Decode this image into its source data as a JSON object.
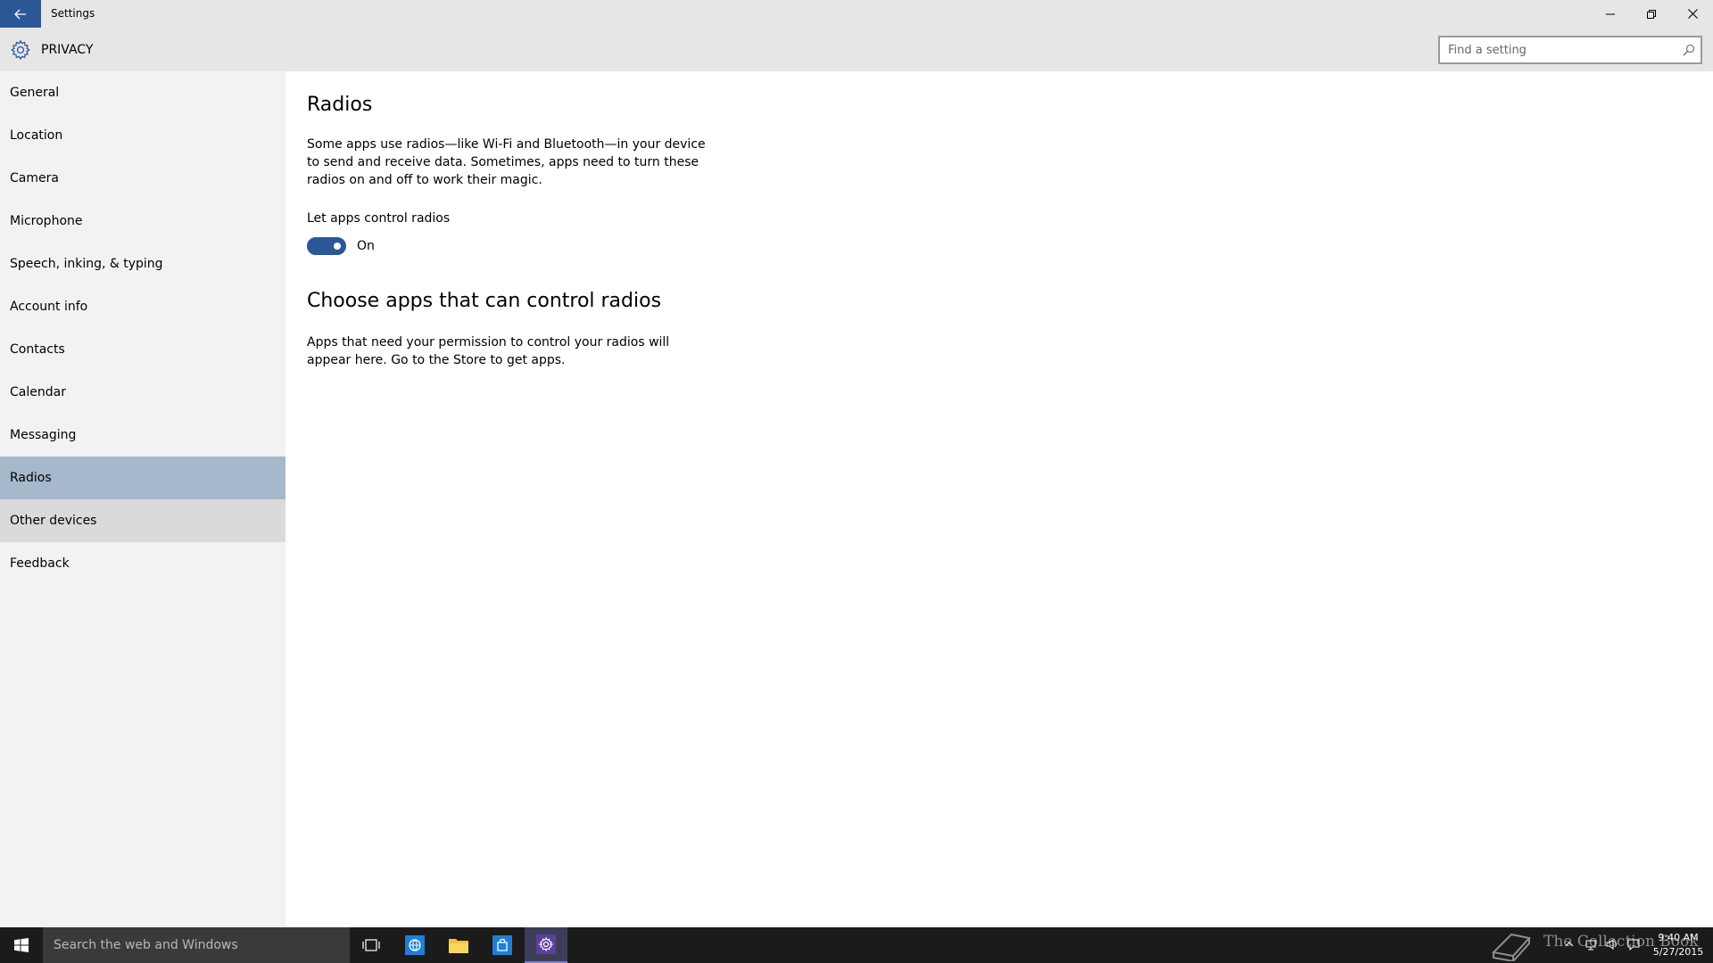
{
  "window": {
    "title": "Settings"
  },
  "header": {
    "title": "PRIVACY",
    "search_placeholder": "Find a setting"
  },
  "sidebar": {
    "items": [
      {
        "label": "General"
      },
      {
        "label": "Location"
      },
      {
        "label": "Camera"
      },
      {
        "label": "Microphone"
      },
      {
        "label": "Speech, inking, & typing"
      },
      {
        "label": "Account info"
      },
      {
        "label": "Contacts"
      },
      {
        "label": "Calendar"
      },
      {
        "label": "Messaging"
      },
      {
        "label": "Radios"
      },
      {
        "label": "Other devices"
      },
      {
        "label": "Feedback"
      }
    ],
    "selected": "Radios"
  },
  "main": {
    "title": "Radios",
    "description": "Some apps use radios—like Wi-Fi and Bluetooth—in your device to send and receive data. Sometimes, apps need to turn these radios on and off to work their magic.",
    "toggle_label": "Let apps control radios",
    "toggle_state": "On",
    "toggle_on": true,
    "section_title": "Choose apps that can control radios",
    "section_description": "Apps that need your permission to control your radios will appear here. Go to the Store to get apps."
  },
  "taskbar": {
    "search_placeholder": "Search the web and Windows",
    "watermark": "The Collection Book",
    "time": "9:40 AM",
    "date": "5/27/2015"
  },
  "colors": {
    "accent": "#2b5797",
    "selected_nav": "#a6b8cc",
    "hover_nav": "#dadada",
    "titlebar": "#e6e6e6",
    "taskbar": "#1b1b1b"
  }
}
